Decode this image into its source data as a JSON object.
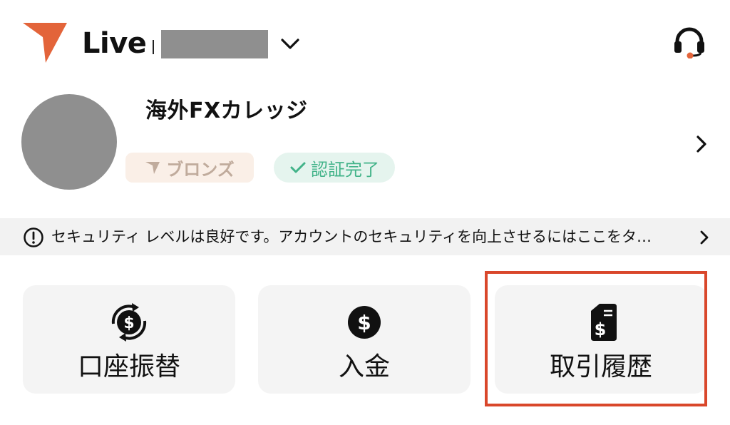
{
  "colors": {
    "brand": "#e3643a",
    "highlight": "#d9472b",
    "verified_green": "#42b389",
    "tier_text": "#c0ab9c",
    "mask_gray": "#8f8f8f"
  },
  "header": {
    "environment_label": "Live",
    "account_dropdown_icon": "chevron-down-icon",
    "support_icon": "headset-icon"
  },
  "profile": {
    "name": "海外FXカレッジ",
    "tier_badge": "ブロンズ",
    "verification_badge": "認証完了",
    "open_icon": "chevron-right-icon"
  },
  "security_notice": {
    "icon": "alert-circle-icon",
    "text": "セキュリティ レベルは良好です。アカウントのセキュリティを向上させるにはここをタ…"
  },
  "actions": [
    {
      "label": "口座振替",
      "icon": "transfer-dollar-icon"
    },
    {
      "label": "入金",
      "icon": "dollar-circle-icon"
    },
    {
      "label": "取引履歴",
      "icon": "receipt-dollar-icon"
    }
  ]
}
